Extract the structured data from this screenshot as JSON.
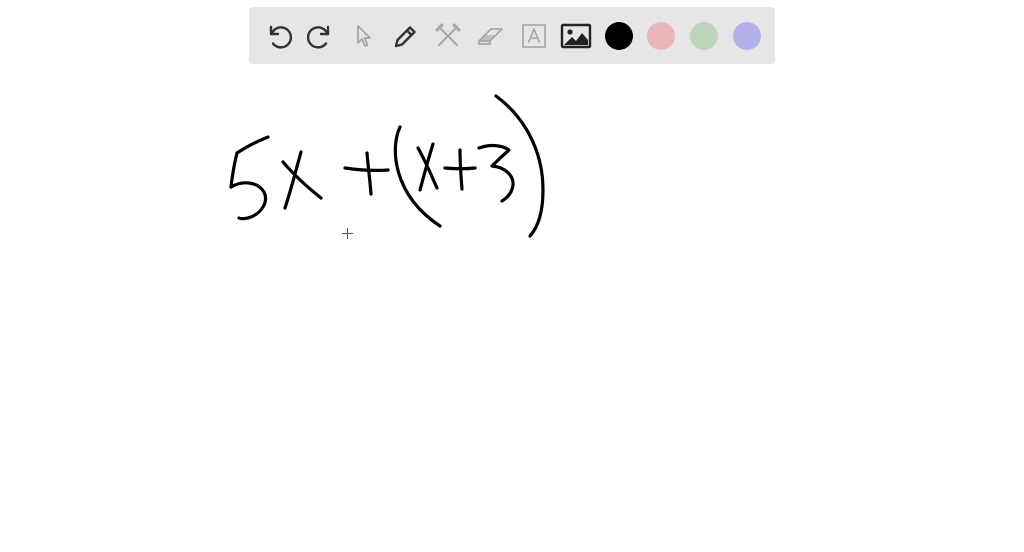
{
  "toolbar": {
    "tools": [
      {
        "name": "undo-icon",
        "enabled": true
      },
      {
        "name": "redo-icon",
        "enabled": true
      },
      {
        "name": "select-pointer-icon",
        "enabled": false
      },
      {
        "name": "pen-icon",
        "enabled": true
      },
      {
        "name": "shapes-tools-icon",
        "enabled": false
      },
      {
        "name": "eraser-icon",
        "enabled": false
      },
      {
        "name": "text-icon",
        "enabled": false
      },
      {
        "name": "image-icon",
        "enabled": true
      }
    ],
    "colors": [
      {
        "name": "color-black",
        "hex": "#000000",
        "selected": true
      },
      {
        "name": "color-pink",
        "hex": "#eab7b9",
        "selected": false
      },
      {
        "name": "color-green",
        "hex": "#bcd4b9",
        "selected": false
      },
      {
        "name": "color-purple",
        "hex": "#b3b0ea",
        "selected": false
      }
    ],
    "icon_color_enabled": "#333333",
    "icon_color_disabled": "#a6a6a6"
  },
  "canvas": {
    "handwriting_icon": "handwritten-expression-icon",
    "cursor_icon": "crosshair-cursor-icon"
  }
}
